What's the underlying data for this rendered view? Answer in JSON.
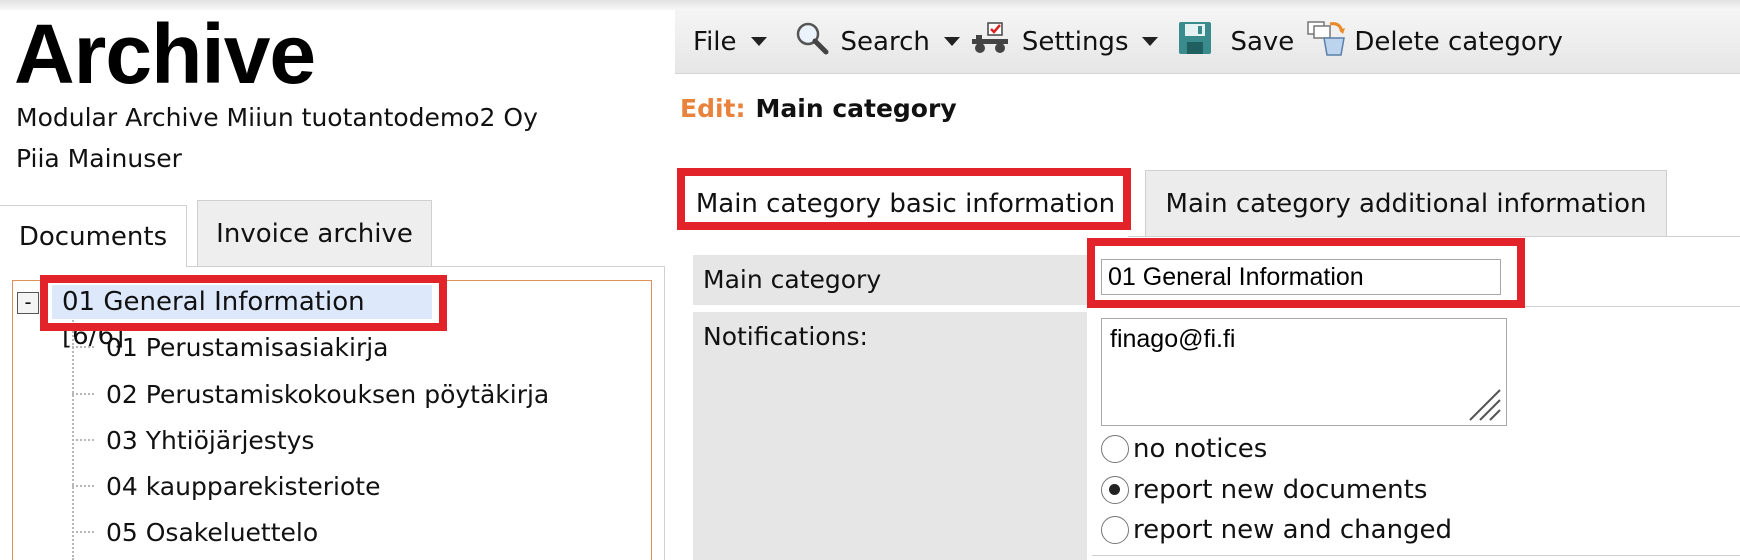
{
  "header": {
    "app_title": "Archive",
    "company": "Modular Archive Miiun tuotantodemo2 Oy",
    "user": "Piia Mainuser"
  },
  "left_tabs": [
    {
      "label": "Documents",
      "active": true
    },
    {
      "label": "Invoice archive",
      "active": false
    }
  ],
  "tree": {
    "toggle": "-",
    "root": "01 General Information [6/6]",
    "items": [
      "01 Perustamisasiakirja",
      "02 Perustamiskokouksen pöytäkirja",
      "03 Yhtiöjärjestys",
      "04 kaupparekisteriote",
      "05 Osakeluettelo"
    ]
  },
  "toolbar": {
    "file": "File",
    "search": "Search",
    "settings": "Settings",
    "save": "Save",
    "delete_category": "Delete category"
  },
  "edit": {
    "label": "Edit:",
    "value": "Main category"
  },
  "right_tabs": [
    {
      "label": "Main category basic information",
      "active": true
    },
    {
      "label": "Main category additional information",
      "active": false
    }
  ],
  "form": {
    "main_category_label": "Main category",
    "main_category_value": "01 General Information",
    "notifications_label": "Notifications:",
    "notifications_value": "finago@fi.fi",
    "options": [
      {
        "label": "no notices",
        "selected": false
      },
      {
        "label": "report new documents",
        "selected": true
      },
      {
        "label": "report new and changed",
        "selected": false
      }
    ]
  },
  "colors": {
    "highlight": "#e3232a",
    "edit_accent": "#e8823d",
    "tree_border": "#e0915a",
    "tree_selection": "#dde8fb"
  }
}
